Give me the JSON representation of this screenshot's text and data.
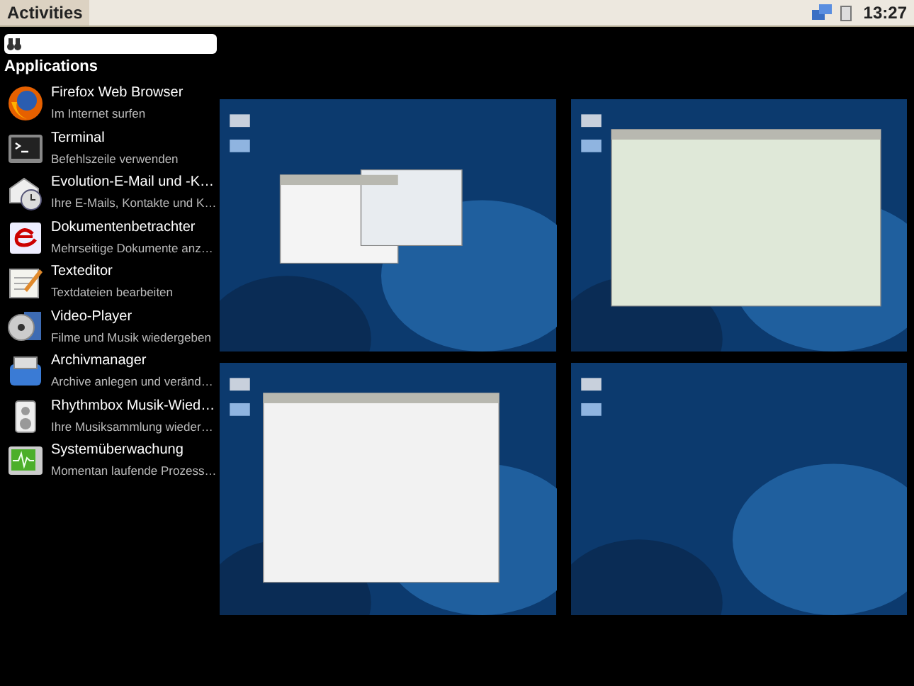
{
  "top_bar": {
    "activities": "Activities",
    "clock": "13:27"
  },
  "applications": {
    "heading": "Applications",
    "items": [
      {
        "kind": "globe",
        "name": "Firefox Web Browser",
        "description": "Im Internet surfen"
      },
      {
        "kind": "terminal",
        "name": "Terminal",
        "description": "Befehlszeile verwenden"
      },
      {
        "kind": "mail",
        "name": "Evolution-E-Mail und -K…",
        "description": "Ihre E-Mails, Kontakte und K…"
      },
      {
        "kind": "document",
        "name": "Dokumentenbetrachter",
        "description": "Mehrseitige Dokumente anz…"
      },
      {
        "kind": "notepad",
        "name": "Texteditor",
        "description": "Textdateien bearbeiten"
      },
      {
        "kind": "disc",
        "name": "Video-Player",
        "description": "Filme und Musik wiedergeben"
      },
      {
        "kind": "archive",
        "name": "Archivmanager",
        "description": "Archive anlegen und veränd…"
      },
      {
        "kind": "speaker",
        "name": "Rhythmbox Musik-Wied…",
        "description": "Ihre Musiksammlung wieder…"
      },
      {
        "kind": "monitor",
        "name": "Systemüberwachung",
        "description": "Momentan laufende Prozess…"
      }
    ]
  }
}
